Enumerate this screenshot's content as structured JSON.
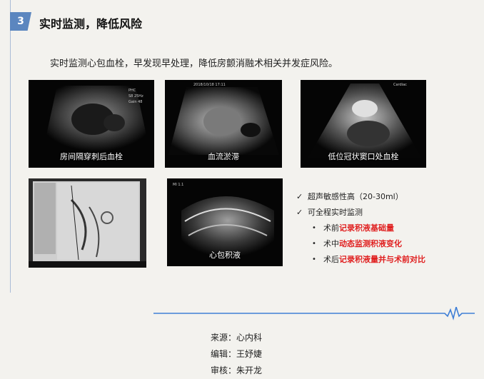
{
  "section": {
    "number": "3",
    "title": "实时监测，降低风险"
  },
  "intro": "实时监测心包血栓，早发现早处理，降低房颤消融术相关并发症风险。",
  "images": [
    {
      "caption": "房间隔穿刺后血栓"
    },
    {
      "caption": "血流淤滞"
    },
    {
      "caption": "低位冠状窦口处血栓"
    },
    {
      "caption": ""
    },
    {
      "caption": "心包积液"
    }
  ],
  "checks": [
    {
      "mark": "✓",
      "text": "超声敏感性高（20-30ml）"
    },
    {
      "mark": "✓",
      "text": "可全程实时监测"
    }
  ],
  "subs": [
    {
      "dot": "•",
      "prefix": "术前",
      "highlight": "记录积液基础量"
    },
    {
      "dot": "•",
      "prefix": "术中",
      "highlight": "动态监测积液变化"
    },
    {
      "dot": "•",
      "prefix": "术后",
      "highlight": "记录积液量并与术前对比"
    }
  ],
  "footer": {
    "source": "来源：心内科",
    "editor": "编辑：王妤婕",
    "reviewer": "审核：朱开龙"
  },
  "colors": {
    "accent": "#5b86bf",
    "highlight": "#e02020",
    "footer_line": "#3f7fd6"
  }
}
